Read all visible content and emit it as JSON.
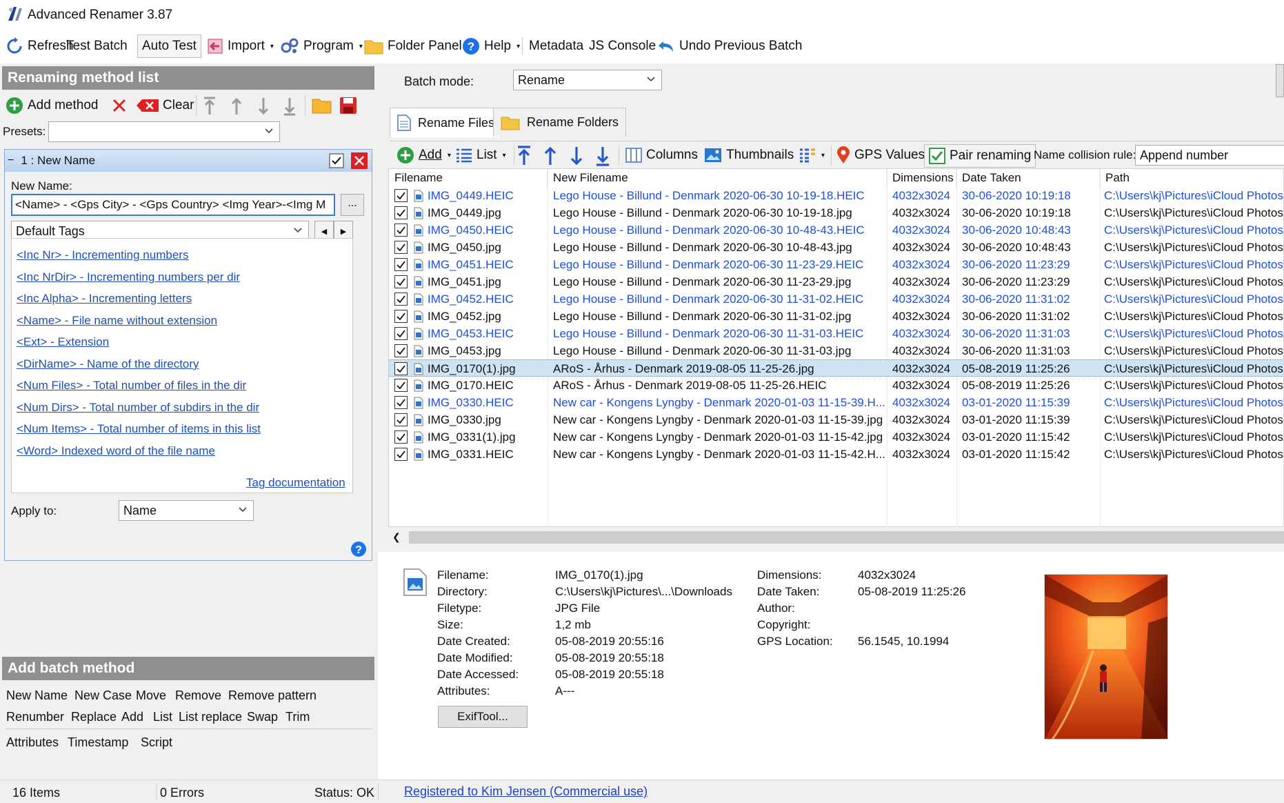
{
  "window": {
    "title": "Advanced Renamer 3.87"
  },
  "toolbar": {
    "refresh": "Refresh",
    "test_batch": "Test Batch",
    "auto_test": "Auto Test",
    "import": "Import",
    "program": "Program",
    "folder_panel": "Folder Panel",
    "help": "Help",
    "metadata": "Metadata",
    "js_console": "JS Console",
    "undo": "Undo Previous Batch"
  },
  "left": {
    "header": "Renaming method list",
    "add_method": "Add method",
    "clear": "Clear",
    "presets_label": "Presets:",
    "presets_value": "",
    "method": {
      "title": "1 : New Name",
      "new_name_label": "New Name:",
      "new_name_value": "<Name> - <Gps City> - <Gps Country> <Img Year>-<Img M",
      "browse": "...",
      "tags_combo": "Default Tags",
      "tags": [
        "<Inc Nr> - Incrementing numbers",
        "<Inc NrDir> - Incrementing numbers per dir",
        "<Inc Alpha> - Incrementing letters",
        "<Name> - File name without extension",
        "<Ext> - Extension",
        "<DirName> - Name of the directory",
        "<Num Files> - Total number of files in the dir",
        "<Num Dirs> - Total number of subdirs in the dir",
        "<Num Items> - Total number of items in this list",
        "<Word> Indexed word of the file name"
      ],
      "tag_doc": "Tag documentation",
      "apply_label": "Apply to:",
      "apply_value": "Name"
    },
    "batch_header": "Add batch method",
    "batch_methods_row1": [
      "New Name",
      "New Case",
      "Move",
      "Remove",
      "Remove pattern"
    ],
    "batch_methods_row2": [
      "Renumber",
      "Replace",
      "Add",
      "List",
      "List replace",
      "Swap",
      "Trim"
    ],
    "batch_methods_row3": [
      "Attributes",
      "Timestamp",
      "Script"
    ]
  },
  "right": {
    "batch_mode_label": "Batch mode:",
    "batch_mode_value": "Rename",
    "tabs": [
      "Rename Files",
      "Rename Folders"
    ],
    "toolbar": {
      "add": "Add",
      "list": "List",
      "columns": "Columns",
      "thumbnails": "Thumbnails",
      "gps": "GPS Values",
      "pair": "Pair renaming",
      "collision_label": "Name collision rule:",
      "collision_value": "Append number"
    },
    "columns": [
      "Filename",
      "New Filename",
      "Dimensions",
      "Date Taken",
      "Path"
    ],
    "rows": [
      {
        "file": "IMG_0449.HEIC",
        "new": "Lego House - Billund - Denmark 2020-06-30 10-19-18.HEIC",
        "dim": "4032x3024",
        "date": "30-06-2020 10:19:18",
        "path": "C:\\Users\\kj\\Pictures\\iCloud Photos",
        "blue": true,
        "sel": false
      },
      {
        "file": "IMG_0449.jpg",
        "new": "Lego House - Billund - Denmark 2020-06-30 10-19-18.jpg",
        "dim": "4032x3024",
        "date": "30-06-2020 10:19:18",
        "path": "C:\\Users\\kj\\Pictures\\iCloud Photos",
        "blue": false,
        "sel": false
      },
      {
        "file": "IMG_0450.HEIC",
        "new": "Lego House - Billund - Denmark 2020-06-30 10-48-43.HEIC",
        "dim": "4032x3024",
        "date": "30-06-2020 10:48:43",
        "path": "C:\\Users\\kj\\Pictures\\iCloud Photos",
        "blue": true,
        "sel": false
      },
      {
        "file": "IMG_0450.jpg",
        "new": "Lego House - Billund - Denmark 2020-06-30 10-48-43.jpg",
        "dim": "4032x3024",
        "date": "30-06-2020 10:48:43",
        "path": "C:\\Users\\kj\\Pictures\\iCloud Photos",
        "blue": false,
        "sel": false
      },
      {
        "file": "IMG_0451.HEIC",
        "new": "Lego House - Billund - Denmark 2020-06-30 11-23-29.HEIC",
        "dim": "4032x3024",
        "date": "30-06-2020 11:23:29",
        "path": "C:\\Users\\kj\\Pictures\\iCloud Photos",
        "blue": true,
        "sel": false
      },
      {
        "file": "IMG_0451.jpg",
        "new": "Lego House - Billund - Denmark 2020-06-30 11-23-29.jpg",
        "dim": "4032x3024",
        "date": "30-06-2020 11:23:29",
        "path": "C:\\Users\\kj\\Pictures\\iCloud Photos",
        "blue": false,
        "sel": false
      },
      {
        "file": "IMG_0452.HEIC",
        "new": "Lego House - Billund - Denmark 2020-06-30 11-31-02.HEIC",
        "dim": "4032x3024",
        "date": "30-06-2020 11:31:02",
        "path": "C:\\Users\\kj\\Pictures\\iCloud Photos",
        "blue": true,
        "sel": false
      },
      {
        "file": "IMG_0452.jpg",
        "new": "Lego House - Billund - Denmark 2020-06-30 11-31-02.jpg",
        "dim": "4032x3024",
        "date": "30-06-2020 11:31:02",
        "path": "C:\\Users\\kj\\Pictures\\iCloud Photos",
        "blue": false,
        "sel": false
      },
      {
        "file": "IMG_0453.HEIC",
        "new": "Lego House - Billund - Denmark 2020-06-30 11-31-03.HEIC",
        "dim": "4032x3024",
        "date": "30-06-2020 11:31:03",
        "path": "C:\\Users\\kj\\Pictures\\iCloud Photos",
        "blue": true,
        "sel": false
      },
      {
        "file": "IMG_0453.jpg",
        "new": "Lego House - Billund - Denmark 2020-06-30 11-31-03.jpg",
        "dim": "4032x3024",
        "date": "30-06-2020 11:31:03",
        "path": "C:\\Users\\kj\\Pictures\\iCloud Photos",
        "blue": false,
        "sel": false
      },
      {
        "file": "IMG_0170(1).jpg",
        "new": "ARoS - Århus - Denmark 2019-08-05 11-25-26.jpg",
        "dim": "4032x3024",
        "date": "05-08-2019 11:25:26",
        "path": "C:\\Users\\kj\\Pictures\\iCloud Photos",
        "blue": false,
        "sel": true
      },
      {
        "file": "IMG_0170.HEIC",
        "new": "ARoS - Århus - Denmark 2019-08-05 11-25-26.HEIC",
        "dim": "4032x3024",
        "date": "05-08-2019 11:25:26",
        "path": "C:\\Users\\kj\\Pictures\\iCloud Photos",
        "blue": false,
        "sel": false
      },
      {
        "file": "IMG_0330.HEIC",
        "new": "New car - Kongens Lyngby - Denmark 2020-01-03 11-15-39.H...",
        "dim": "4032x3024",
        "date": "03-01-2020 11:15:39",
        "path": "C:\\Users\\kj\\Pictures\\iCloud Photos",
        "blue": true,
        "sel": false
      },
      {
        "file": "IMG_0330.jpg",
        "new": "New car - Kongens Lyngby - Denmark 2020-01-03 11-15-39.jpg",
        "dim": "4032x3024",
        "date": "03-01-2020 11:15:39",
        "path": "C:\\Users\\kj\\Pictures\\iCloud Photos",
        "blue": false,
        "sel": false
      },
      {
        "file": "IMG_0331(1).jpg",
        "new": "New car - Kongens Lyngby - Denmark 2020-01-03 11-15-42.jpg",
        "dim": "4032x3024",
        "date": "03-01-2020 11:15:42",
        "path": "C:\\Users\\kj\\Pictures\\iCloud Photos",
        "blue": false,
        "sel": false
      },
      {
        "file": "IMG_0331.HEIC",
        "new": "New car - Kongens Lyngby - Denmark 2020-01-03 11-15-42.H...",
        "dim": "4032x3024",
        "date": "03-01-2020 11:15:42",
        "path": "C:\\Users\\kj\\Pictures\\iCloud Photos",
        "blue": false,
        "sel": false
      }
    ],
    "details": {
      "filename_label": "Filename:",
      "filename": "IMG_0170(1).jpg",
      "directory_label": "Directory:",
      "directory": "C:\\Users\\kj\\Pictures\\...\\Downloads",
      "filetype_label": "Filetype:",
      "filetype": "JPG File",
      "size_label": "Size:",
      "size": "1,2 mb",
      "created_label": "Date Created:",
      "created": "05-08-2019 20:55:16",
      "modified_label": "Date Modified:",
      "modified": "05-08-2019 20:55:18",
      "accessed_label": "Date Accessed:",
      "accessed": "05-08-2019 20:55:18",
      "attributes_label": "Attributes:",
      "attributes": "A---",
      "exif_button": "ExifTool...",
      "dimensions_label": "Dimensions:",
      "dimensions": "4032x3024",
      "taken_label": "Date Taken:",
      "taken": "05-08-2019 11:25:26",
      "author_label": "Author:",
      "author": "",
      "copyright_label": "Copyright:",
      "copyright": "",
      "gps_label": "GPS Location:",
      "gps": "56.1545, 10.1994"
    }
  },
  "status": {
    "items": "16 Items",
    "errors": "0 Errors",
    "status": "Status: OK",
    "registered": "Registered to Kim Jensen (Commercial use)"
  },
  "colors": {
    "blue_text": "#1e4fd4",
    "header_gray": "#8f8f8f",
    "selection": "#cde4f7",
    "link": "#1f4fb0"
  }
}
